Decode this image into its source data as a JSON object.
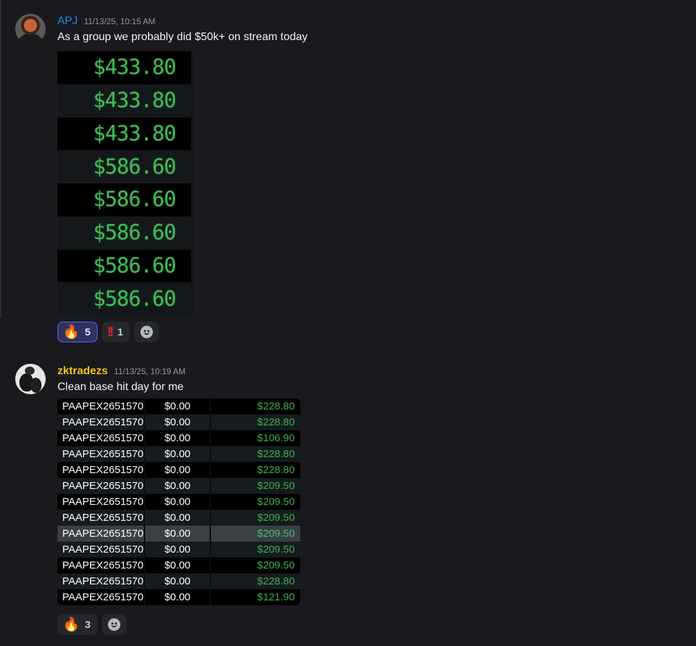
{
  "messages": [
    {
      "username": "APJ",
      "username_color": "#1e8fe8",
      "timestamp": "11/13/25, 10:15 AM",
      "text": "As a group we probably did $50k+ on stream today",
      "image_prices": [
        "$433.80",
        "$433.80",
        "$433.80",
        "$586.60",
        "$586.60",
        "$586.60",
        "$586.60",
        "$586.60"
      ],
      "reactions": [
        {
          "emoji": "fire",
          "count": "5",
          "active": true
        },
        {
          "emoji": "double-exclamation",
          "count": "1",
          "active": false
        }
      ]
    },
    {
      "username": "zktradezs",
      "username_color": "#f0c419",
      "timestamp": "11/13/25, 10:19 AM",
      "text": "Clean base hit day for me",
      "table_rows": [
        {
          "symbol": "PAAPEX2651570",
          "value": "$0.00",
          "pnl": "$228.80"
        },
        {
          "symbol": "PAAPEX2651570",
          "value": "$0.00",
          "pnl": "$228.80"
        },
        {
          "symbol": "PAAPEX2651570",
          "value": "$0.00",
          "pnl": "$106.90"
        },
        {
          "symbol": "PAAPEX2651570",
          "value": "$0.00",
          "pnl": "$228.80"
        },
        {
          "symbol": "PAAPEX2651570",
          "value": "$0.00",
          "pnl": "$228.80"
        },
        {
          "symbol": "PAAPEX2651570",
          "value": "$0.00",
          "pnl": "$209.50"
        },
        {
          "symbol": "PAAPEX2651570",
          "value": "$0.00",
          "pnl": "$209.50"
        },
        {
          "symbol": "PAAPEX2651570",
          "value": "$0.00",
          "pnl": "$209.50"
        },
        {
          "symbol": "PAAPEX2651570",
          "value": "$0.00",
          "pnl": "$209.50",
          "selected": true
        },
        {
          "symbol": "PAAPEX2651570",
          "value": "$0.00",
          "pnl": "$209.50"
        },
        {
          "symbol": "PAAPEX2651570",
          "value": "$0.00",
          "pnl": "$209.50"
        },
        {
          "symbol": "PAAPEX2651570",
          "value": "$0.00",
          "pnl": "$228.80"
        },
        {
          "symbol": "PAAPEX2651570",
          "value": "$0.00",
          "pnl": "$121.90"
        }
      ],
      "reactions": [
        {
          "emoji": "fire",
          "count": "3",
          "active": false
        }
      ]
    }
  ]
}
